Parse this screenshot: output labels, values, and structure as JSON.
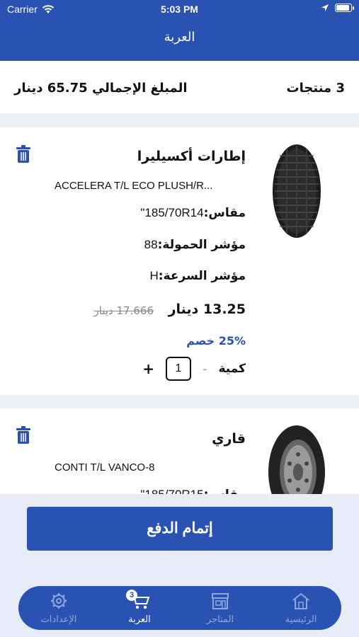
{
  "status": {
    "carrier": "Carrier",
    "time": "5:03 PM",
    "battery_level": 0.95
  },
  "header": {
    "title": "العربة"
  },
  "summary": {
    "count": "3 منتجات",
    "total": "المبلغ الإجمالي 65.75 دينار"
  },
  "products": [
    {
      "name": "إطارات أكسيليرا",
      "model": "ACCELERA T/L ECO PLUSH/R...",
      "size_label": "مقاس:",
      "size_value": "185/70R14\"",
      "load_label": "مؤشر الحمولة:",
      "load_value": "88",
      "speed_label": "مؤشر السرعة:",
      "speed_value": "H",
      "price": "13.25 دينار",
      "old_price": "17.666 دينار",
      "discount": "25% خصم",
      "qty_label": "كمية",
      "qty": "1",
      "minus": "-",
      "plus": "+"
    },
    {
      "name": "قاري",
      "model": "CONTI T/L VANCO-8",
      "size_label": "مقاس:",
      "size_value": "185/70R15\""
    }
  ],
  "checkout": {
    "label": "إتمام الدفع"
  },
  "tabbar": {
    "items": [
      {
        "label": "الرئيسية",
        "icon": "home-icon"
      },
      {
        "label": "المتاجر",
        "icon": "store-icon"
      },
      {
        "label": "العربة",
        "icon": "cart-icon",
        "badge": "3"
      },
      {
        "label": "الإعدادات",
        "icon": "gear-icon"
      }
    ]
  },
  "colors": {
    "primary": "#2a52b3",
    "background": "#edf0f5",
    "discount": "#2a52b3"
  }
}
